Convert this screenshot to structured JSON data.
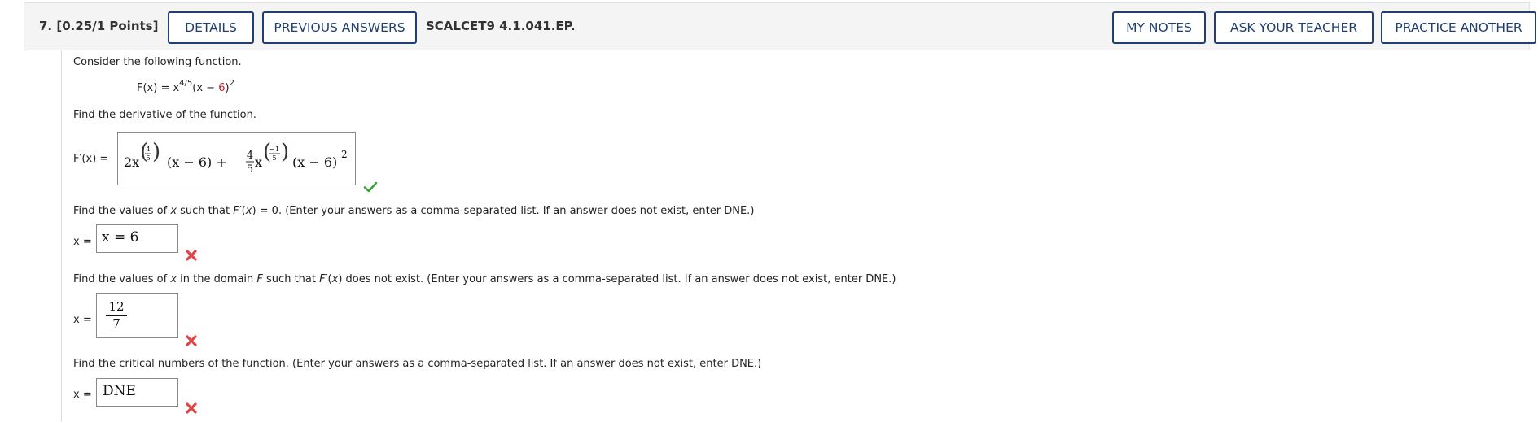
{
  "header": {
    "question_number": "7.",
    "points": "[0.25/1 Points]",
    "details_label": "DETAILS",
    "previous_answers_label": "PREVIOUS ANSWERS",
    "question_id": "SCALCET9 4.1.041.EP.",
    "my_notes_label": "MY NOTES",
    "ask_teacher_label": "ASK YOUR TEACHER",
    "practice_another_label": "PRACTICE ANOTHER"
  },
  "problem": {
    "intro": "Consider the following function.",
    "function_lhs": "F(x) = x",
    "function_exponent": "4/5",
    "function_paren_open": "(x − ",
    "function_six": "6",
    "function_paren_close": ")",
    "function_square": "2",
    "part1_prompt": "Find the derivative of the function.",
    "part1_label": "F′(x) =",
    "part1_answer": {
      "t1": "2x",
      "e1_num": "4",
      "e1_den": "5",
      "t2": "(x − 6) +",
      "c_num": "4",
      "c_den": "5",
      "t3": "x",
      "e2_num": "−1",
      "e2_den": "5",
      "t4": "(x − 6)",
      "t4_sup": "2"
    },
    "part1_status": "correct",
    "part2_prompt": "Find the values of x such that F′(x) = 0. (Enter your answers as a comma-separated list. If an answer does not exist, enter DNE.)",
    "part2_label": "x =",
    "part2_answer": "x = 6",
    "part2_status": "incorrect",
    "part3_prompt": "Find the values of x in the domain F such that F′(x) does not exist. (Enter your answers as a comma-separated list. If an answer does not exist, enter DNE.)",
    "part3_label": "x =",
    "part3_num": "12",
    "part3_den": "7",
    "part3_status": "incorrect",
    "part4_prompt": "Find the critical numbers of the function. (Enter your answers as a comma-separated list. If an answer does not exist, enter DNE.)",
    "part4_label": "x =",
    "part4_answer": "DNE",
    "part4_status": "incorrect"
  },
  "colors": {
    "button_border": "#1f3f73",
    "correct": "#3aa33a",
    "incorrect": "#e04545",
    "highlight_red": "#d02020"
  }
}
